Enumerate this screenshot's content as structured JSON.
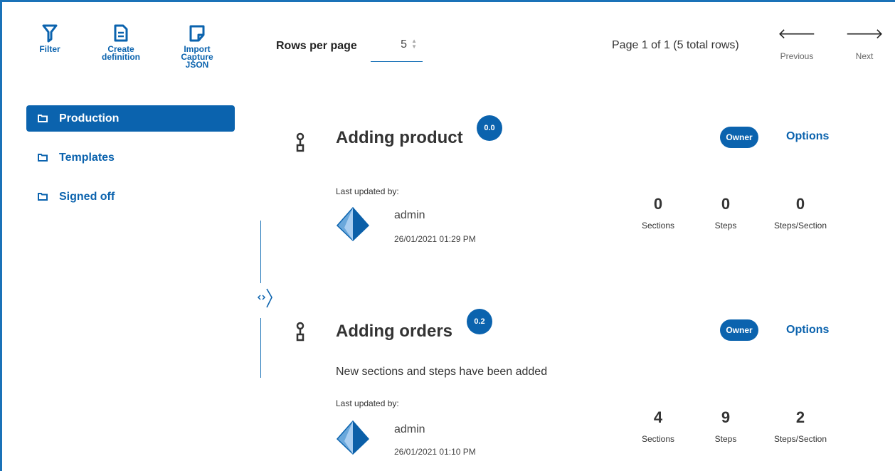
{
  "toolbar": {
    "filter_label": "Filter",
    "create_label": "Create definition",
    "import_label": "Import Capture JSON"
  },
  "pagination": {
    "rows_per_page_label": "Rows per page",
    "rows_per_page_value": "5",
    "page_info": "Page 1 of 1 (5 total rows)",
    "previous_label": "Previous",
    "next_label": "Next"
  },
  "sidebar": {
    "items": [
      {
        "label": "Production",
        "active": true
      },
      {
        "label": "Templates",
        "active": false
      },
      {
        "label": "Signed off",
        "active": false
      }
    ]
  },
  "cards": [
    {
      "title": "Adding product",
      "version": "0.0",
      "owner_label": "Owner",
      "options_label": "Options",
      "description": "",
      "last_updated_label": "Last updated by:",
      "user": "admin",
      "date": "26/01/2021 01:29 PM",
      "stats": [
        {
          "value": "0",
          "label": "Sections"
        },
        {
          "value": "0",
          "label": "Steps"
        },
        {
          "value": "0",
          "label": "Steps/Section"
        }
      ]
    },
    {
      "title": "Adding orders",
      "version": "0.2",
      "owner_label": "Owner",
      "options_label": "Options",
      "description": "New sections and steps have been added",
      "last_updated_label": "Last updated by:",
      "user": "admin",
      "date": "26/01/2021 01:10 PM",
      "stats": [
        {
          "value": "4",
          "label": "Sections"
        },
        {
          "value": "9",
          "label": "Steps"
        },
        {
          "value": "2",
          "label": "Steps/Section"
        }
      ]
    }
  ],
  "colors": {
    "accent": "#0b63ae",
    "border": "#1a72b8"
  }
}
